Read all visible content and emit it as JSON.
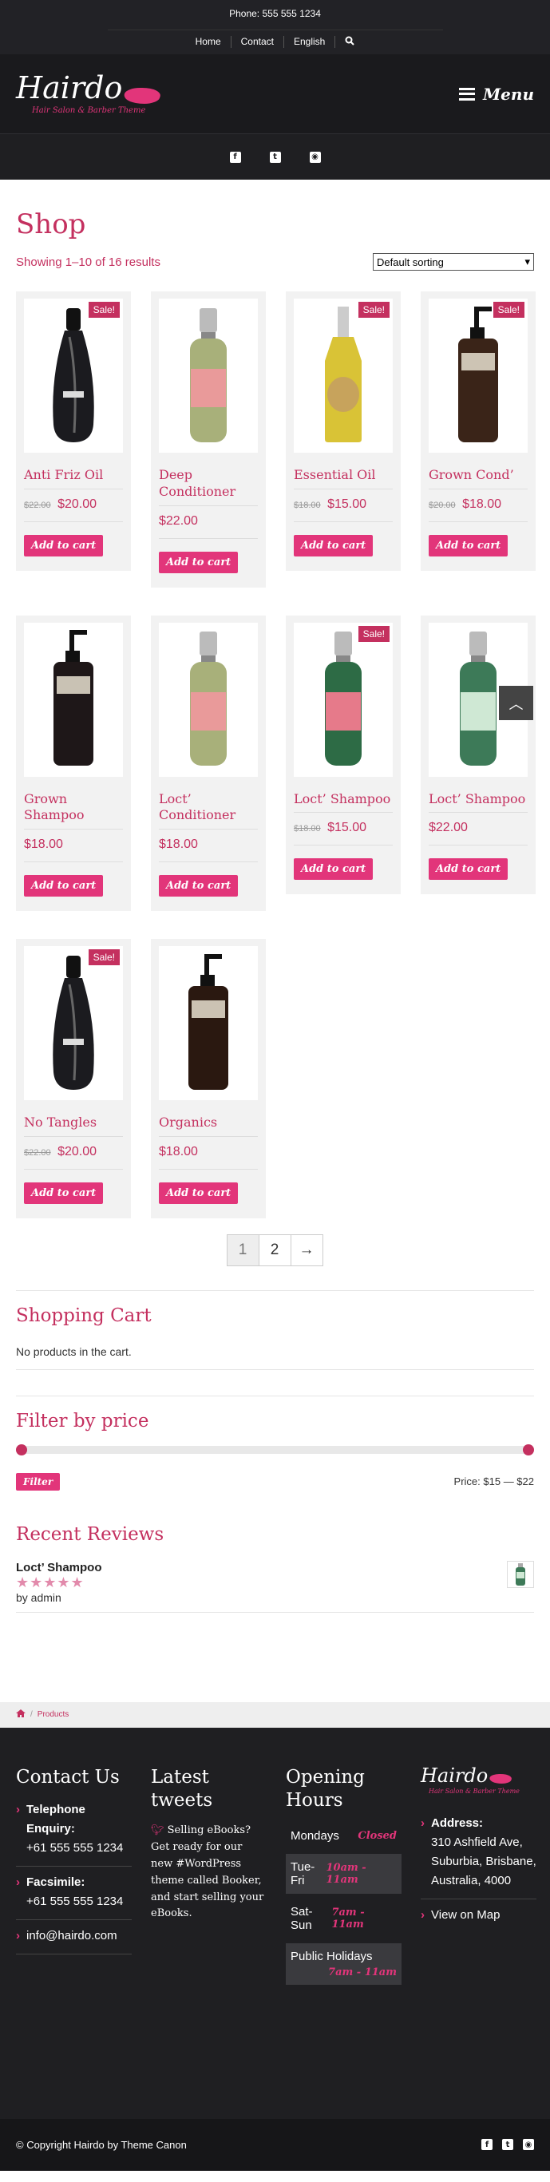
{
  "topbar": {
    "phone": "Phone: 555 555 1234",
    "nav": [
      "Home",
      "Contact",
      "English"
    ]
  },
  "header": {
    "logo_name": "Hairdo",
    "logo_tagline": "Hair Salon & Barber Theme",
    "menu_label": "Menu"
  },
  "social": {
    "icons": [
      "facebook-icon",
      "twitter-icon",
      "rss-icon"
    ]
  },
  "shop": {
    "title": "Shop",
    "result_count": "Showing 1–10 of 16 results",
    "sort_selected": "Default sorting",
    "sale_badge": "Sale!",
    "add_to_cart": "Add to cart",
    "products": [
      {
        "name": "Anti Friz Oil",
        "old_price": "$22.00",
        "price": "$20.00",
        "sale": true
      },
      {
        "name": "Deep Conditioner",
        "old_price": "",
        "price": "$22.00",
        "sale": false
      },
      {
        "name": "Essential Oil",
        "old_price": "$18.00",
        "price": "$15.00",
        "sale": true
      },
      {
        "name": "Grown Cond’",
        "old_price": "$20.00",
        "price": "$18.00",
        "sale": true
      },
      {
        "name": "Grown Shampoo",
        "old_price": "",
        "price": "$18.00",
        "sale": false
      },
      {
        "name": "Loct’ Conditioner",
        "old_price": "",
        "price": "$18.00",
        "sale": false
      },
      {
        "name": "Loct’ Shampoo",
        "old_price": "$18.00",
        "price": "$15.00",
        "sale": true
      },
      {
        "name": "Loct’ Shampoo",
        "old_price": "",
        "price": "$22.00",
        "sale": false
      },
      {
        "name": "No Tangles",
        "old_price": "$22.00",
        "price": "$20.00",
        "sale": true
      },
      {
        "name": "Organics",
        "old_price": "",
        "price": "$18.00",
        "sale": false
      }
    ],
    "pagination": {
      "current": "1",
      "next_page": "2",
      "next_arrow": "→"
    }
  },
  "cart_widget": {
    "title": "Shopping Cart",
    "empty_text": "No products in the cart."
  },
  "price_filter": {
    "title": "Filter by price",
    "button": "Filter",
    "range_text": "Price: $15 — $22",
    "min_fraction": 0,
    "max_fraction": 1
  },
  "reviews": {
    "title": "Recent Reviews",
    "product": "Loct’ Shampoo",
    "author": "by admin",
    "stars": "★★★★★",
    "rating": 5
  },
  "breadcrumb": {
    "label": "Products"
  },
  "footer": {
    "contact": {
      "title": "Contact Us",
      "phone_label": "Telephone Enquiry:",
      "phone": "+61 555 555 1234",
      "fax_label": "Facsimile:",
      "fax": "+61 555 555 1234",
      "email": "info@hairdo.com"
    },
    "tweets": {
      "title": "Latest tweets",
      "text": "Selling eBooks? Get ready for our new #WordPress theme called Booker, and start selling your eBooks."
    },
    "hours": {
      "title": "Opening Hours",
      "rows": [
        {
          "day": "Mondays",
          "time": "Closed"
        },
        {
          "day": "Tue-Fri",
          "time": "10am - 11am"
        },
        {
          "day": "Sat-Sun",
          "time": "7am - 11am"
        },
        {
          "day": "Public Holidays",
          "time": "7am - 11am"
        }
      ]
    },
    "address": {
      "logo_name": "Hairdo",
      "logo_tagline": "Hair Salon & Barber Theme",
      "label": "Address:",
      "lines": "310 Ashfield Ave, Suburbia, Brisbane, Australia, 4000",
      "map_link": "View on Map"
    },
    "copyright": "© Copyright Hairdo by Theme Canon"
  },
  "colors": {
    "accent": "#e2357a",
    "heading": "#c4305f",
    "dark": "#1f1f22"
  }
}
